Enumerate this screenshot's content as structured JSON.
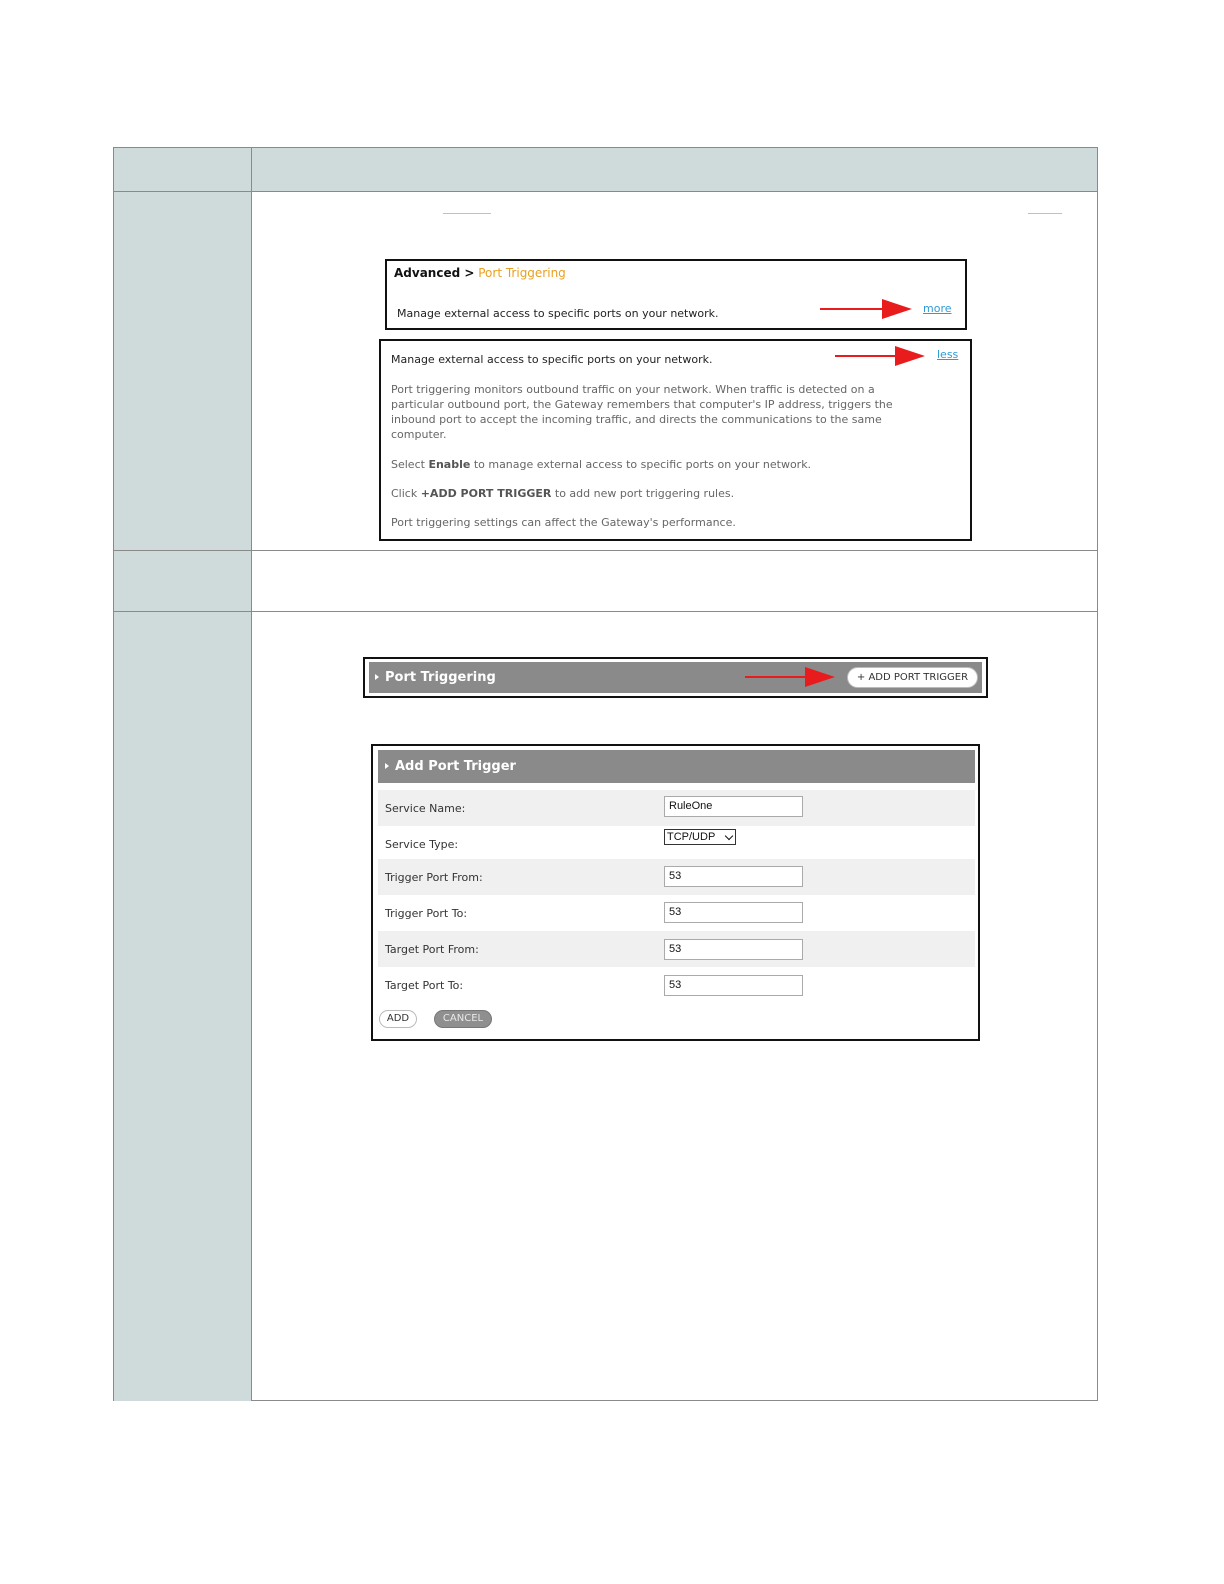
{
  "panel1": {
    "breadcrumb_parent": "Advanced >",
    "breadcrumb_current": "Port Triggering",
    "summary": "Manage external access to specific ports on your network.",
    "more_link": "more"
  },
  "panel2": {
    "summary": "Manage external access to specific ports on your network.",
    "less_link": "less",
    "para1": "Port triggering monitors outbound traffic on your network. When traffic is detected on a particular outbound port, the Gateway remembers that computer's IP address, triggers the inbound port to accept the incoming traffic, and directs the communications to the same computer.",
    "para2_prefix": "Select",
    "para2_bold": "Enable",
    "para2_suffix": "to manage external access to specific ports on your network.",
    "para3_prefix": "Click",
    "para3_bold": "+ADD PORT TRIGGER",
    "para3_suffix": "to add new port triggering rules.",
    "para4": "Port triggering settings can affect the Gateway's performance."
  },
  "port_triggering_bar": {
    "title": "Port Triggering",
    "add_button": "+ ADD PORT TRIGGER"
  },
  "add_form": {
    "title": "Add Port Trigger",
    "fields": [
      {
        "label": "Service Name:",
        "value": "RuleOne"
      },
      {
        "label": "Service Type:",
        "value": "TCP/UDP"
      },
      {
        "label": "Trigger Port From:",
        "value": "53"
      },
      {
        "label": "Trigger Port To:",
        "value": "53"
      },
      {
        "label": "Target Port From:",
        "value": "53"
      },
      {
        "label": "Target Port To:",
        "value": "53"
      }
    ],
    "add_button": "ADD",
    "cancel_button": "CANCEL"
  },
  "colors": {
    "table_header_bg": "#cfdadb",
    "arrow": "#e81c1c",
    "link": "#2f9ad6",
    "breadcrumb_current": "#e8a020",
    "bar_bg": "#8a8a8a"
  }
}
